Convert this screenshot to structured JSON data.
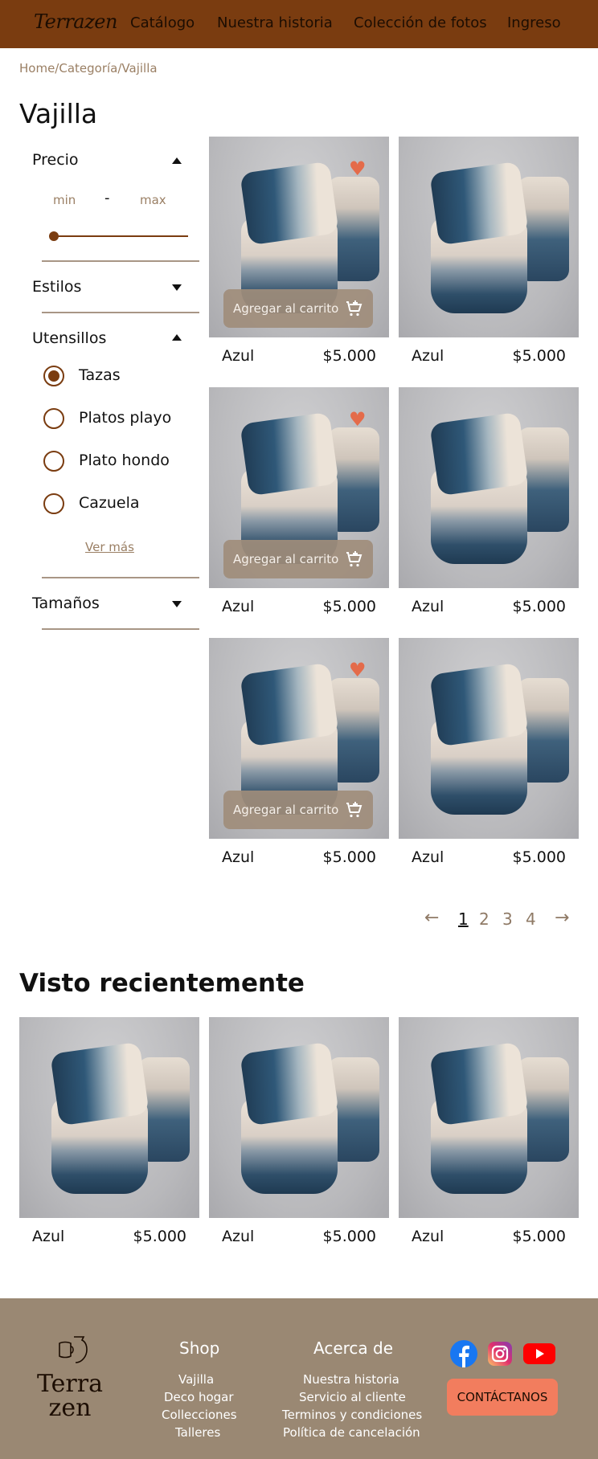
{
  "header": {
    "logo": "Terrazen",
    "nav": [
      "Catálogo",
      "Nuestra historia",
      "Colección de fotos",
      "Ingreso"
    ]
  },
  "breadcrumb": "Home/Categoría/Vajilla",
  "page_title": "Vajilla",
  "filters": {
    "price": {
      "label": "Precio",
      "min_placeholder": "min",
      "separator": "-",
      "max_placeholder": "max"
    },
    "styles": {
      "label": "Estilos"
    },
    "utensils": {
      "label": "Utensillos",
      "options": [
        "Tazas",
        "Platos playo",
        "Plato hondo",
        "Cazuela"
      ],
      "selected": "Tazas",
      "more": "Ver más"
    },
    "sizes": {
      "label": "Tamaños"
    }
  },
  "products": [
    {
      "name": "Azul",
      "price": "$5.000",
      "cart_label": "Agregar al carrito",
      "favorite": true
    },
    {
      "name": "Azul",
      "price": "$5.000"
    },
    {
      "name": "Azul",
      "price": "$5.000",
      "cart_label": "Agregar al carrito",
      "favorite": true
    },
    {
      "name": "Azul",
      "price": "$5.000"
    },
    {
      "name": "Azul",
      "price": "$5.000",
      "cart_label": "Agregar al carrito",
      "favorite": true
    },
    {
      "name": "Azul",
      "price": "$5.000"
    }
  ],
  "pagination": {
    "pages": [
      "1",
      "2",
      "3",
      "4"
    ],
    "current": "1"
  },
  "recent": {
    "title": "Visto recientemente",
    "items": [
      {
        "name": "Azul",
        "price": "$5.000"
      },
      {
        "name": "Azul",
        "price": "$5.000"
      },
      {
        "name": "Azul",
        "price": "$5.000"
      }
    ]
  },
  "footer": {
    "logo_line1": "Terra",
    "logo_line2": "zen",
    "shop": {
      "title": "Shop",
      "links": [
        "Vajilla",
        "Deco hogar",
        "Collecciones",
        "Talleres"
      ]
    },
    "about": {
      "title": "Acerca de",
      "links": [
        "Nuestra historia",
        "Servicio al cliente",
        "Terminos y condiciones",
        "Política de cancelación"
      ]
    },
    "contact": "CONTÁCTANOS"
  },
  "colors": {
    "brand": "#7a3c10",
    "accent": "#f27d5e",
    "footer": "#9a8873"
  }
}
